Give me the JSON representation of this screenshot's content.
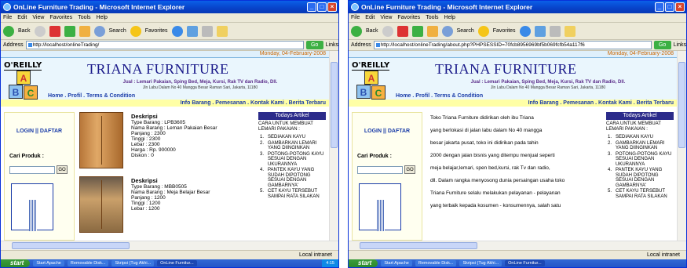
{
  "windows": [
    {
      "title": "OnLine Furniture Trading - Microsoft Internet Explorer",
      "menu": [
        "File",
        "Edit",
        "View",
        "Favorites",
        "Tools",
        "Help"
      ],
      "toolbar": {
        "back": "Back",
        "search": "Search",
        "favorites": "Favorites"
      },
      "address_label": "Address",
      "url": "http://localhost/onlineTrading/",
      "go": "Go",
      "links": "Links"
    },
    {
      "title": "OnLine Furniture Trading - Microsoft Internet Explorer",
      "menu": [
        "File",
        "Edit",
        "View",
        "Favorites",
        "Tools",
        "Help"
      ],
      "toolbar": {
        "back": "Back",
        "search": "Search",
        "favorites": "Favorites"
      },
      "address_label": "Address",
      "url": "http://localhost/onlineTrading/about.php?PHPSESSID=70fcb8956969bf5b069fcfb54a117f6",
      "go": "Go",
      "links": "Links"
    }
  ],
  "site": {
    "date": "Monday, 04-February-2008",
    "brand": "O'REILLY",
    "title": "TRIANA FURNITURE",
    "tagline": "Jual : Lemari Pakaian, Sping Bed, Meja, Kursi, Rak TV dan Radio, Dll.",
    "address": "Jln Labu Dalam No 40 Mangga Besar Raman Sari, Jakarta, 11180",
    "nav_left": "Home . Profil . Terms & Condition",
    "nav_right": "Info Barang . Pemesanan . Kontak Kami . Berita Terbaru",
    "login": "LOGIN || DAFTAR",
    "search_label": "Cari Produk :",
    "search_go": "GO",
    "article_header": "Todays Artikel",
    "article_title": "CARA UNTUK MEMBUAT LEMARI PAKAIAN :",
    "article_steps": [
      "SEDIAKAN KAYU",
      "GAMBARKAN LEMARI YANG DIINGINKAN",
      "POTONG-POTONG KAYU SESUAI DENGAN UKURANNYA",
      "PANTEK KAYU YANG SUDAH DIPOTONG SESUAI DENGAN GAMBARNYA'",
      "CET KAYU TERSEBUT SAMPAI RATA SILAKAN"
    ]
  },
  "products": [
    {
      "heading": "Deskripsi",
      "type": "Type Barang : LPB3605",
      "name": "Nama Barang : Leman Pakaian Besar",
      "length": "Panjang : 2300",
      "height": "Tinggi : 2300",
      "width": "Lebar : 2300",
      "price": "Harga : Rp. 900000",
      "discount": "Diskon : 0"
    },
    {
      "heading": "Deskripsi",
      "type": "Type Barang : MBB0505",
      "name": "Nama Barang : Meja Belajar Besar",
      "length": "Panjang : 1200",
      "height": "Tinggi : 1200",
      "width": "Lebar : 1200"
    }
  ],
  "about_lines": [
    "Toko Triana Furniture didirikan oleh ibu Triana",
    "yang berlokasi di jalan labu dalam No 40 mangga",
    "besar jakarta pusat, toko ini didirikan pada tahin",
    "2000 dengan jalan bisnis yang ditempu menjual seperti",
    "meja belajar,lemari, spen bed,kursi, rak Tv dan radio,",
    "dll. Dalam rangka menyosong dunia persaingan usaha toko",
    "Triana Furniture selalu melakukan pelayanan - pelayanan",
    "yang terbaik kepada kosumen - konsumennya, salah satu"
  ],
  "status": {
    "zone": "Local intranet"
  },
  "taskbar": {
    "start": "start",
    "left_buttons": [
      "Start Apache",
      "Removable Disk...",
      "Skripsi (Tug Akhi...",
      "OnLine Furnitur..."
    ],
    "right_buttons": [
      "Start Apache",
      "Removable Disk...",
      "Skripsi (Tug Akhi...",
      "OnLine Furnitur..."
    ],
    "clock": "4:15"
  }
}
